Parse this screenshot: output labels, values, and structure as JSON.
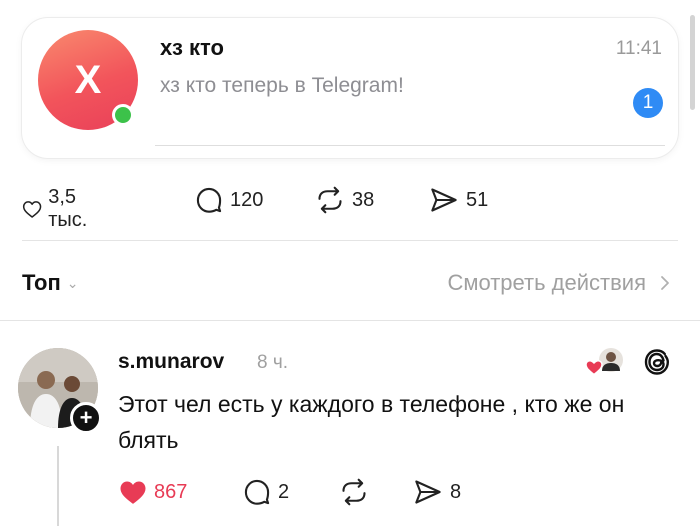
{
  "notification": {
    "avatar_letter": "X",
    "title": "хз кто",
    "time": "11:41",
    "message": "хз кто теперь в Telegram!",
    "unread_count": "1",
    "avatar_colors": [
      "#f98a6e",
      "#e9405a"
    ],
    "online_color": "#3cc24a",
    "badge_color": "#2f8bf5"
  },
  "post_stats": {
    "likes": "3,5 тыс.",
    "comments": "120",
    "reposts": "38",
    "shares": "51"
  },
  "sort": {
    "label": "Топ",
    "activity_link": "Смотреть действия"
  },
  "reply": {
    "username": "s.munarov",
    "time_ago": "8 ч.",
    "text": "Этот чел есть у каждого в телефоне , кто же он блять",
    "likes": "867",
    "comments": "2",
    "shares": "8",
    "liked": true,
    "like_color": "#e83b55",
    "icons": [
      "heart-icon",
      "comment-icon",
      "repost-icon",
      "share-icon",
      "threads-icon"
    ]
  }
}
